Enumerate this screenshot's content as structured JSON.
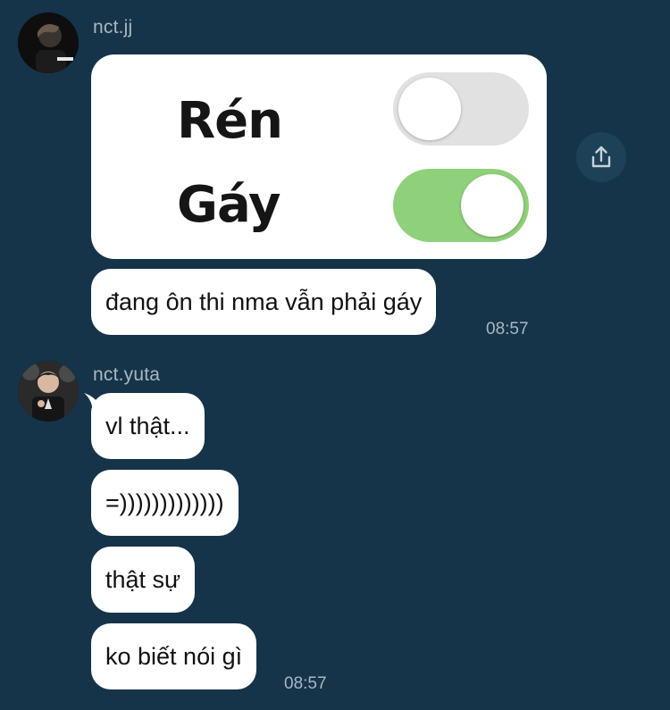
{
  "messages": [
    {
      "sender": "nct.jj",
      "image": {
        "toggles": [
          {
            "label": "Rén",
            "state": "off"
          },
          {
            "label": "Gáy",
            "state": "on"
          }
        ]
      },
      "bubbles": [
        "đang ôn thi nma vẫn phải gáy"
      ],
      "time": "08:57"
    },
    {
      "sender": "nct.yuta",
      "bubbles": [
        "vl thật...",
        "=)))))))))))))",
        "thật sự",
        "ko biết nói gì"
      ],
      "time": "08:57"
    }
  ],
  "colors": {
    "background": "#15344a",
    "bubble": "#ffffff",
    "meta_text": "#a9b7c1",
    "toggle_on": "#8fd07a",
    "toggle_off": "#e1e1e1"
  },
  "icons": {
    "share": "share-icon"
  }
}
